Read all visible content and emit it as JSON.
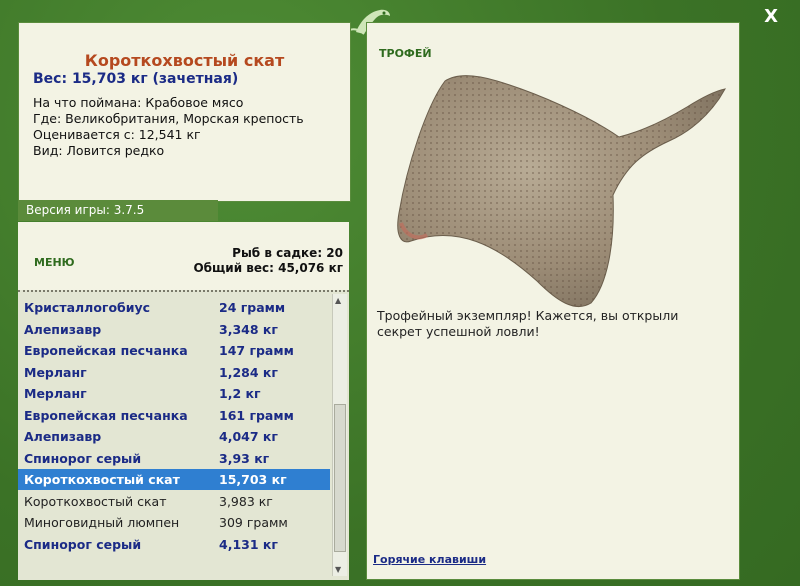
{
  "window": {
    "close_label": "X"
  },
  "catch": {
    "name": "Короткохвостый скат",
    "weight_line": "Вес: 15,703 кг (зачетная)",
    "bait": "На что поймана: Крабовое мясо",
    "location": "Где: Великобритания, Морская крепость",
    "value": "Оценивается с: 12,541 кг",
    "rarity": "Вид: Ловится редко"
  },
  "version": "Версия игры: 3.7.5",
  "menu_label": "МЕНЮ",
  "keepnet": {
    "fish_count": "Рыб в садке: 20",
    "total_weight": "Общий вес: 45,076 кг"
  },
  "fish_list": [
    {
      "name": "Кристаллогобиус",
      "weight": "24 грамм",
      "style": "bold"
    },
    {
      "name": "Алепизавр",
      "weight": "3,348 кг",
      "style": "bold"
    },
    {
      "name": "Европейская песчанка",
      "weight": "147 грамм",
      "style": "bold"
    },
    {
      "name": "Мерланг",
      "weight": "1,284 кг",
      "style": "bold"
    },
    {
      "name": "Мерланг",
      "weight": "1,2 кг",
      "style": "bold"
    },
    {
      "name": "Европейская песчанка",
      "weight": "161 грамм",
      "style": "bold"
    },
    {
      "name": "Алепизавр",
      "weight": "4,047 кг",
      "style": "bold"
    },
    {
      "name": "Спинорог серый",
      "weight": "3,93 кг",
      "style": "bold"
    },
    {
      "name": "Короткохвостый скат",
      "weight": "15,703 кг",
      "style": "sel"
    },
    {
      "name": "Короткохвостый скат",
      "weight": "3,983 кг",
      "style": "plain"
    },
    {
      "name": "Миноговидный люмпен",
      "weight": "309 грамм",
      "style": "plain"
    },
    {
      "name": "Спинорог серый",
      "weight": "4,131 кг",
      "style": "bold"
    }
  ],
  "trophy_label": "ТРОФЕЙ",
  "trophy_message": "Трофейный экземпляр! Кажется, вы открыли секрет успешной ловли!",
  "hotkeys_label": "Горячие клавиши",
  "colors": {
    "frame": "#3f7a2a",
    "title": "#b5491f",
    "link": "#1b2b86",
    "selection": "#2f7fd1"
  }
}
